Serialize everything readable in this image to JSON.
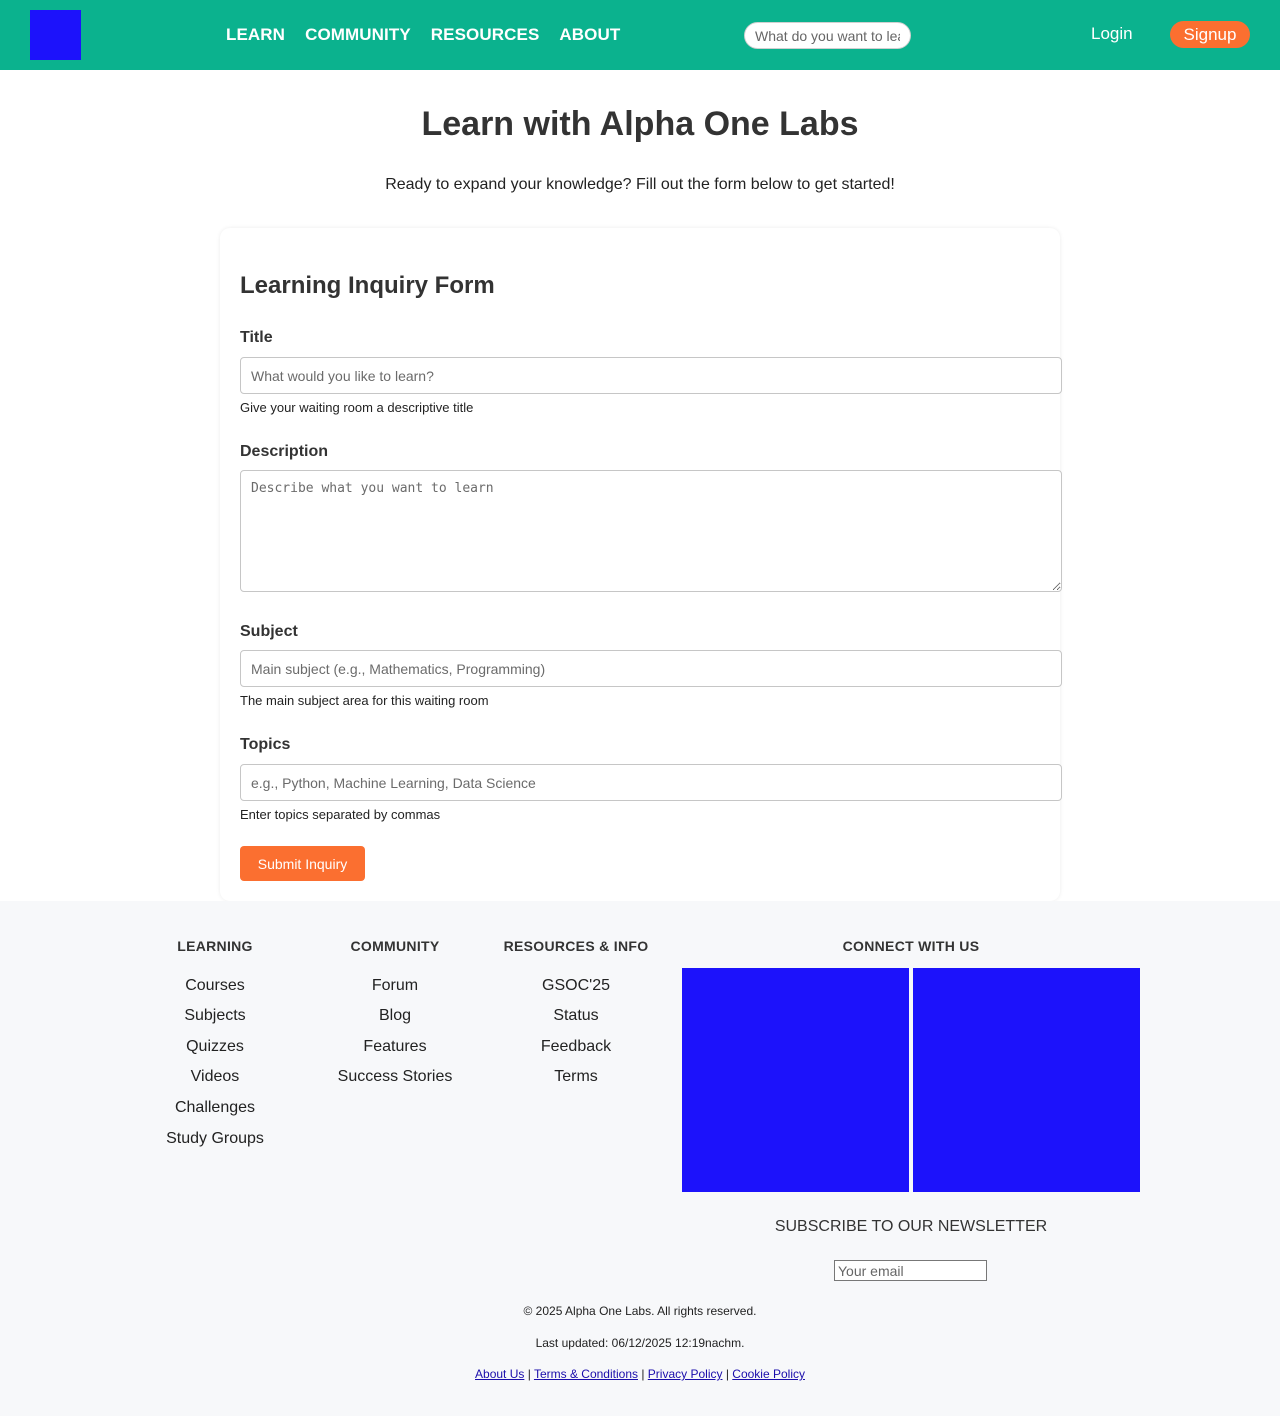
{
  "header": {
    "nav": [
      "LEARN",
      "COMMUNITY",
      "RESOURCES",
      "ABOUT"
    ],
    "search_placeholder": "What do you want to learn?",
    "login": "Login",
    "signup": "Signup"
  },
  "hero": {
    "title": "Learn with Alpha One Labs",
    "subtitle": "Ready to expand your knowledge? Fill out the form below to get started!"
  },
  "form": {
    "title": "Learning Inquiry Form",
    "fields": {
      "title": {
        "label": "Title",
        "placeholder": "What would you like to learn?",
        "help": "Give your waiting room a descriptive title"
      },
      "description": {
        "label": "Description",
        "placeholder": "Describe what you want to learn"
      },
      "subject": {
        "label": "Subject",
        "placeholder": "Main subject (e.g., Mathematics, Programming)",
        "help": "The main subject area for this waiting room"
      },
      "topics": {
        "label": "Topics",
        "placeholder": "e.g., Python, Machine Learning, Data Science",
        "help": "Enter topics separated by commas"
      }
    },
    "submit": "Submit Inquiry"
  },
  "footer": {
    "columns": [
      {
        "heading": "LEARNING",
        "links": [
          "Courses",
          "Subjects",
          "Quizzes",
          "Videos",
          "Challenges",
          "Study Groups"
        ]
      },
      {
        "heading": "COMMUNITY",
        "links": [
          "Forum",
          "Blog",
          "Features",
          "Success Stories"
        ]
      },
      {
        "heading": "RESOURCES & INFO",
        "links": [
          "GSOC'25",
          "Status",
          "Feedback",
          "Terms"
        ]
      }
    ],
    "connect_heading": "CONNECT WITH US",
    "newsletter_heading": "SUBSCRIBE TO OUR NEWSLETTER",
    "email_placeholder": "Your email",
    "copyright": "© 2025 Alpha One Labs. All rights reserved.",
    "last_updated": "Last updated: 06/12/2025 12:19nachm.",
    "legal": [
      "About Us",
      "Terms & Conditions",
      "Privacy Policy",
      "Cookie Policy"
    ]
  },
  "colors": {
    "header_bg": "#0bb28e",
    "accent": "#fb6f30",
    "placeholder_blue": "#1c12fb",
    "footer_bg": "#f7f8fa"
  }
}
